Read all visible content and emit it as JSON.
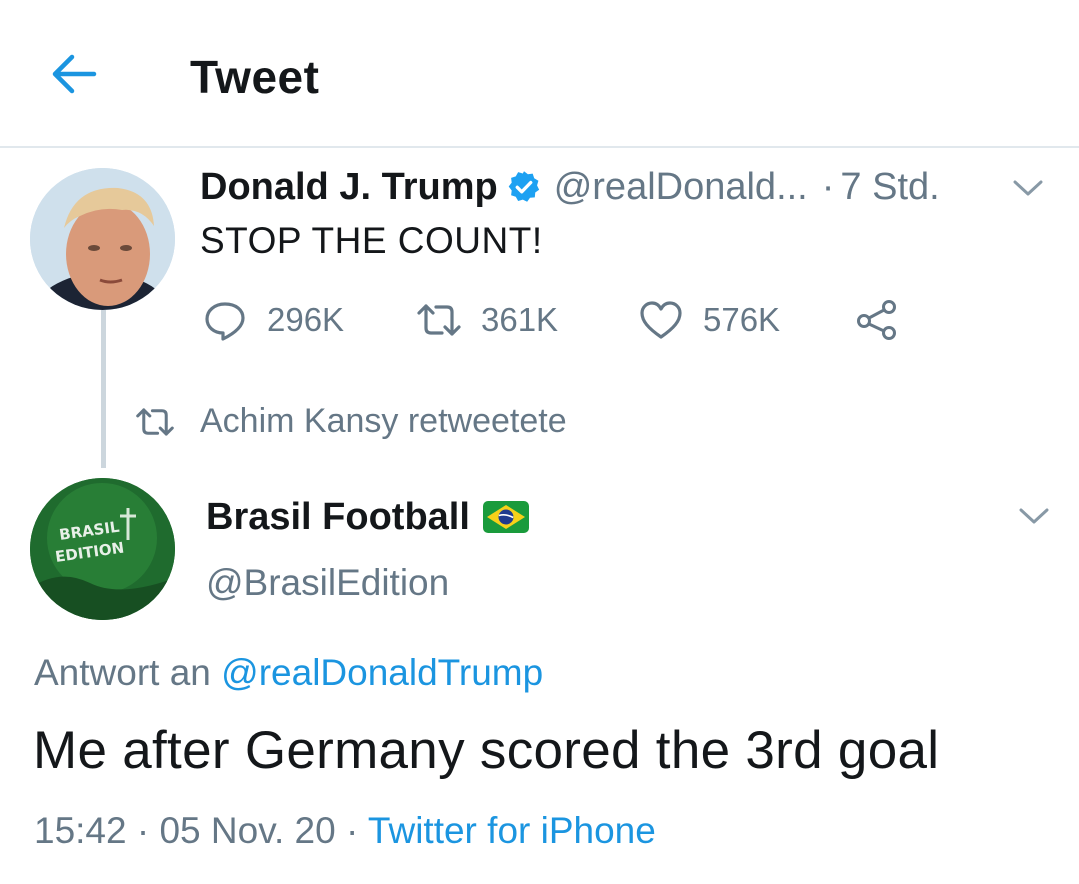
{
  "header": {
    "back_icon": "arrow-left-icon",
    "title": "Tweet"
  },
  "colors": {
    "accent": "#1b95e0",
    "secondary_text": "#657786",
    "primary_text": "#14171a",
    "divider": "#e1e8ed",
    "verified": "#1da1f2"
  },
  "quoted_tweet": {
    "display_name": "Donald J. Trump",
    "verified_icon": "verified-badge-icon",
    "handle": "@realDonald...",
    "separator": "·",
    "time": "7 Std.",
    "text": "STOP THE COUNT!",
    "actions": {
      "replies": "296K",
      "retweets": "361K",
      "likes": "576K"
    }
  },
  "retweet_context": {
    "icon": "retweet-icon",
    "text": "Achim Kansy retweetete"
  },
  "main_tweet": {
    "display_name": "Brasil Football",
    "flag_icon": "brazil-flag-icon",
    "handle": "@BrasilEdition",
    "reply_prefix": "Antwort an",
    "reply_to": "@realDonaldTrump",
    "text": "Me after Germany scored the 3rd goal",
    "time": "15:42",
    "date": "05 Nov. 20",
    "separator": "·",
    "source": "Twitter for iPhone"
  }
}
